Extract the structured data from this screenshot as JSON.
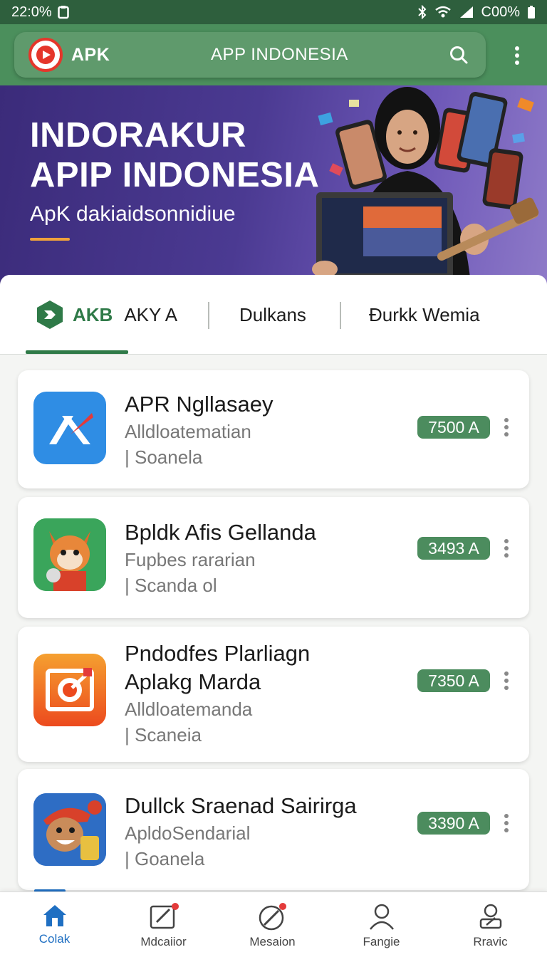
{
  "status_bar": {
    "time": "22:0%",
    "battery": "C00%"
  },
  "app_bar": {
    "brand": "APK",
    "title": "APP INDONESIA"
  },
  "hero": {
    "title_line1": "INDORAKUR",
    "title_line2": "APIP INDONESIA",
    "subtitle": "ApK dakiaidsonnidiue"
  },
  "tabs": [
    {
      "prefix": "AKB",
      "label": "AKY A",
      "active": true
    },
    {
      "label": "Dulkans",
      "active": false
    },
    {
      "label": "Ðurkk Wemia",
      "active": false
    }
  ],
  "apps": [
    {
      "name": "APR Ngllasaey",
      "category": "Alldloatematian",
      "developer": "| Soanela",
      "badge": "7500 A",
      "icon": "blue-x-icon",
      "color": "#2f8de4"
    },
    {
      "name": "Bpldk Afis Gellanda",
      "category": "Fupbes rararian",
      "developer": "| Scanda ol",
      "badge": "3493 A",
      "icon": "fox-character-icon",
      "color": "#3aa55b"
    },
    {
      "name_line1": "Pndodfes Plarliagn",
      "name_line2": "Aplakg Marda",
      "category": "Alldloatemanda",
      "developer": "| Scaneia",
      "badge": "7350 A",
      "icon": "orange-target-icon",
      "color": "#f06a24"
    },
    {
      "name": "Dullck Sraenad Sairirga",
      "category": "ApldoSendarial",
      "developer": "| Goanela",
      "badge": "3390 A",
      "icon": "cartoon-boy-icon",
      "color": "#2e6dc4"
    }
  ],
  "bottom_nav": [
    {
      "label": "Colak",
      "icon": "home-icon",
      "active": true
    },
    {
      "label": "Mdcaiior",
      "icon": "edit-doc-icon",
      "active": false
    },
    {
      "label": "Mesaion",
      "icon": "pen-circle-icon",
      "active": false
    },
    {
      "label": "Fangie",
      "icon": "person-icon",
      "active": false
    },
    {
      "label": "Rravic",
      "icon": "profile-edit-icon",
      "active": false
    }
  ],
  "colors": {
    "status_bar": "#2e5f3d",
    "app_bar": "#5f9a6c",
    "accent": "#2f7a48",
    "badge": "#4c8c5e",
    "nav_active": "#1f6fc2"
  }
}
